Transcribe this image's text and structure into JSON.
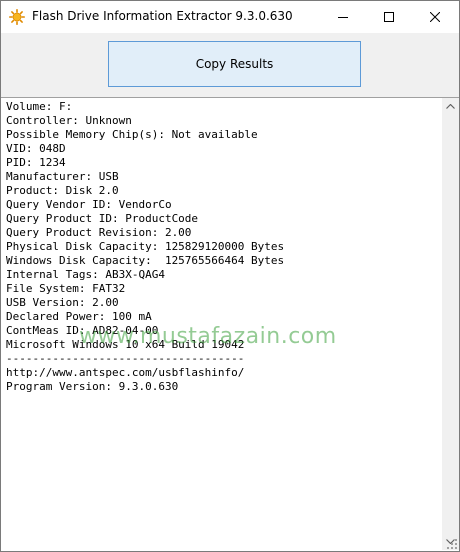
{
  "window": {
    "title": "Flash Drive Information Extractor 9.3.0.630",
    "icon": "sun-app-icon"
  },
  "titlebar": {
    "minimize_icon": "minimize-icon",
    "maximize_icon": "maximize-icon",
    "close_icon": "close-icon"
  },
  "toolbar": {
    "copy_label": "Copy Results"
  },
  "results": {
    "lines": [
      "Volume: F:",
      "Controller: Unknown",
      "Possible Memory Chip(s): Not available",
      "VID: 048D",
      "PID: 1234",
      "Manufacturer: USB",
      "Product: Disk 2.0",
      "Query Vendor ID: VendorCo",
      "Query Product ID: ProductCode",
      "Query Product Revision: 2.00",
      "Physical Disk Capacity: 125829120000 Bytes",
      "Windows Disk Capacity:  125765566464 Bytes",
      "Internal Tags: AB3X-QAG4",
      "File System: FAT32",
      "USB Version: 2.00",
      "Declared Power: 100 mA",
      "ContMeas ID: AD82-04-00",
      "Microsoft Windows 10 x64 Build 19042",
      "------------------------------------",
      "http://www.antspec.com/usbflashinfo/",
      "Program Version: 9.3.0.630"
    ]
  },
  "watermark": {
    "text": "www.mustafazain.com"
  },
  "colors": {
    "button_bg": "#e1eef9",
    "button_border": "#5d9ad7",
    "watermark": "#3ca03c"
  }
}
